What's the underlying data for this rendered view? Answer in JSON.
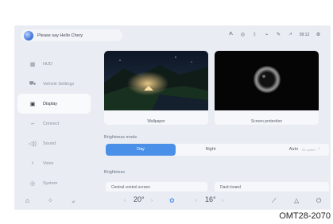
{
  "header": {
    "voice_prompt": "Please say Hello Chery",
    "status_icons": [
      "ᗑ",
      "◎",
      "ᛒ",
      "⌁",
      "✎",
      "⩘"
    ],
    "time": "09:12",
    "settings_icon": "⚙"
  },
  "sidebar": {
    "items": [
      {
        "label": "HUD",
        "icon": "▦",
        "icon_name": "hud-icon"
      },
      {
        "label": "Vehicle Settings",
        "icon": "⛟",
        "icon_name": "car-icon"
      },
      {
        "label": "Display",
        "icon": "▣",
        "icon_name": "display-icon",
        "active": true
      },
      {
        "label": "Connect",
        "icon": "∽",
        "icon_name": "link-icon"
      },
      {
        "label": "Sound",
        "icon": "◁))",
        "icon_name": "speaker-icon"
      },
      {
        "label": "Voice",
        "icon": "♁",
        "icon_name": "microphone-icon"
      },
      {
        "label": "System",
        "icon": "◎",
        "icon_name": "gear-icon"
      }
    ]
  },
  "content": {
    "wallpaper_label": "Wallpaper",
    "screen_protection_label": "Screen protection",
    "brightness_mode_label": "Brightness mode",
    "modes": {
      "day": "Day",
      "night": "Night",
      "auto": "Auto",
      "auto_sub": "The system"
    },
    "brightness_label": "Brightness",
    "central_screen_label": "Central control screen",
    "dashboard_label": "Dash board"
  },
  "dock": {
    "home_icon": "⌂",
    "apps_icon": "⁘",
    "seat_icon": "⟓",
    "left_temp": "20°",
    "fan_icon": "✿",
    "right_temp": "16°",
    "arrow_left": "‹",
    "arrow_right": "›",
    "wiper_icon": "⟋",
    "warning_icon": "△",
    "power_icon": "⏻"
  },
  "figure_code": "OMT28-2070",
  "colors": {
    "accent": "#4a90e8",
    "background": "#e9edf3",
    "card": "#f5f7fa"
  }
}
